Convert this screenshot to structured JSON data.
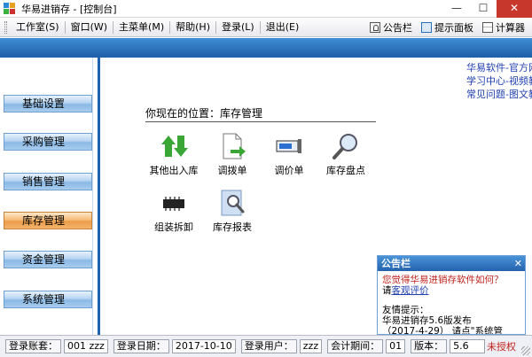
{
  "window": {
    "title": "华易进销存 - [控制台]"
  },
  "menu": {
    "items": [
      "工作室(S)",
      "窗口(W)",
      "主菜单(M)",
      "帮助(H)",
      "登录(L)",
      "退出(E)"
    ],
    "tools": [
      "公告栏",
      "提示面板",
      "计算器"
    ]
  },
  "sidebar": {
    "items": [
      "基础设置",
      "采购管理",
      "销售管理",
      "库存管理",
      "资金管理",
      "系统管理"
    ],
    "active": "库存管理"
  },
  "links": [
    "华易软件-官方网站",
    "学习中心-视频教程",
    "常见问题-图文教程"
  ],
  "location": "你现在的位置：库存管理",
  "functions": [
    "其他出入库",
    "调拨单",
    "调价单",
    "库存盘点",
    "组装拆卸",
    "库存报表"
  ],
  "notice": {
    "title": "公告栏",
    "line1": "您觉得华易进销存软件如何？",
    "line2_prefix": "请",
    "line2_link": "客观评价",
    "line3": "友情提示：",
    "line4": "华易进销存5.6版发布",
    "line5": "（2017-4-29） 请点\"系统管"
  },
  "status": {
    "account_label": "登录账套：",
    "account_value": "001 zzz",
    "date_label": "登录日期：",
    "date_value": "2017-10-10",
    "user_label": "登录用户：",
    "user_value": "zzz",
    "period_label": "会计期间：",
    "period_value": "01",
    "version_label": "版本：",
    "version_value": "5.6",
    "license": "未授权"
  },
  "colors": {
    "accent_blue": "#1e5fa8",
    "active_orange": "#ec9c48",
    "link_blue": "#1f3fb0",
    "alert_red": "#c0201a"
  }
}
